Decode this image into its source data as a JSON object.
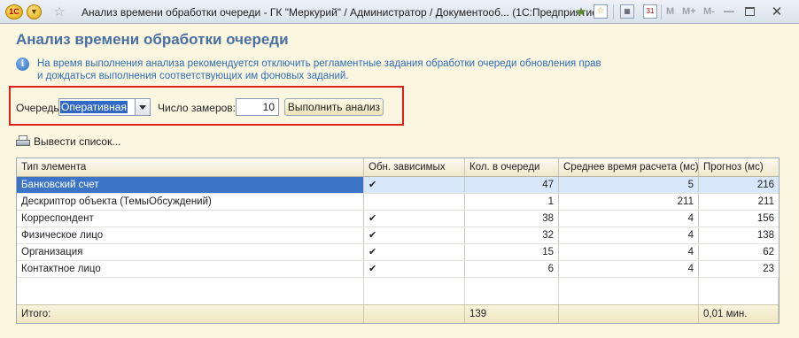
{
  "window": {
    "logo_text": "1С",
    "title": "Анализ времени обработки очереди - ГК \"Меркурий\" / Администратор / Документооб...  (1С:Предприятие)",
    "toolbar_m_buttons": [
      "M",
      "M+",
      "M-"
    ],
    "minimize_glyph": "—",
    "close_glyph": "✕"
  },
  "form": {
    "heading": "Анализ времени обработки очереди",
    "info_text": "На время выполнения анализа рекомендуется отключить регламентные задания обработки очереди обновления прав и дождаться выполнения соответствующих им фоновых заданий.",
    "queue_label": "Очередь:",
    "queue_value": "Оперативная",
    "count_label": "Число замеров:",
    "count_value": "10",
    "run_button": "Выполнить анализ",
    "export_label": "Вывести список..."
  },
  "table": {
    "columns": [
      "Тип элемента",
      "Обн. зависимых",
      "Кол. в очереди",
      "Среднее время расчета (мс)",
      "Прогноз (мс)"
    ],
    "rows": [
      {
        "type": "Банковский счет",
        "deps": "✔",
        "count": "47",
        "avg": "5",
        "forecast": "216"
      },
      {
        "type": "Дескриптор объекта (ТемыОбсуждений)",
        "deps": "",
        "count": "1",
        "avg": "211",
        "forecast": "211"
      },
      {
        "type": "Корреспондент",
        "deps": "✔",
        "count": "38",
        "avg": "4",
        "forecast": "156"
      },
      {
        "type": "Физическое лицо",
        "deps": "✔",
        "count": "32",
        "avg": "4",
        "forecast": "138"
      },
      {
        "type": "Организация",
        "deps": "✔",
        "count": "15",
        "avg": "4",
        "forecast": "62"
      },
      {
        "type": "Контактное лицо",
        "deps": "✔",
        "count": "6",
        "avg": "4",
        "forecast": "23"
      }
    ],
    "footer": {
      "label": "Итого:",
      "count": "139",
      "forecast": "0,01 мин."
    }
  }
}
